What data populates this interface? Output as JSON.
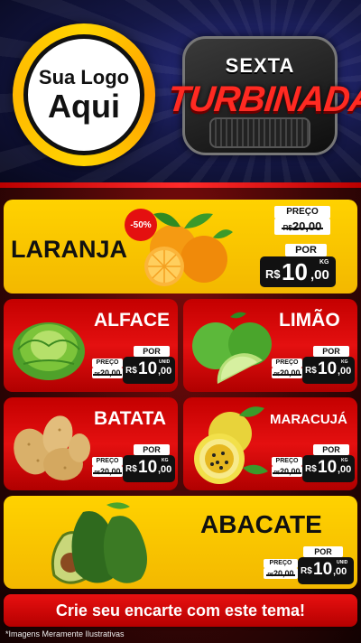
{
  "header": {
    "logo_line1": "Sua Logo",
    "logo_line2": "Aqui",
    "badge_top": "SEXTA",
    "badge_main": "TURBINADA"
  },
  "colors": {
    "red": "#e41010",
    "yellow": "#ffd200",
    "black": "#111111",
    "header_blue": "#151848"
  },
  "products": [
    {
      "name": "LARANJA",
      "discount": "-50%",
      "preco_label": "PREÇO",
      "old_currency": "R$",
      "old_price": "20,00",
      "por_label": "POR",
      "currency": "R$",
      "price_int": "10",
      "price_cents": ",00",
      "unit": "KG",
      "icon": "orange-icon"
    },
    {
      "name": "ALFACE",
      "preco_label": "PREÇO",
      "old_currency": "R$",
      "old_price": "20,00",
      "por_label": "POR",
      "currency": "R$",
      "price_int": "10",
      "price_cents": ",00",
      "unit": "UNID",
      "icon": "lettuce-icon"
    },
    {
      "name": "LIMÃO",
      "preco_label": "PREÇO",
      "old_currency": "R$",
      "old_price": "20,00",
      "por_label": "POR",
      "currency": "R$",
      "price_int": "10",
      "price_cents": ",00",
      "unit": "KG",
      "icon": "lime-icon"
    },
    {
      "name": "BATATA",
      "preco_label": "PREÇO",
      "old_currency": "R$",
      "old_price": "20,00",
      "por_label": "POR",
      "currency": "R$",
      "price_int": "10",
      "price_cents": ",00",
      "unit": "KG",
      "icon": "potato-icon"
    },
    {
      "name": "MARACUJÁ",
      "preco_label": "PREÇO",
      "old_currency": "R$",
      "old_price": "20,00",
      "por_label": "POR",
      "currency": "R$",
      "price_int": "10",
      "price_cents": ",00",
      "unit": "KG",
      "icon": "passion-fruit-icon"
    },
    {
      "name": "ABACATE",
      "preco_label": "PREÇO",
      "old_currency": "R$",
      "old_price": "20,00",
      "por_label": "POR",
      "currency": "R$",
      "price_int": "10",
      "price_cents": ",00",
      "unit": "UNID",
      "icon": "avocado-icon"
    }
  ],
  "footer": {
    "cta": "Crie seu encarte com este tema!",
    "disclaimer": "*Imagens Meramente Ilustrativas"
  }
}
